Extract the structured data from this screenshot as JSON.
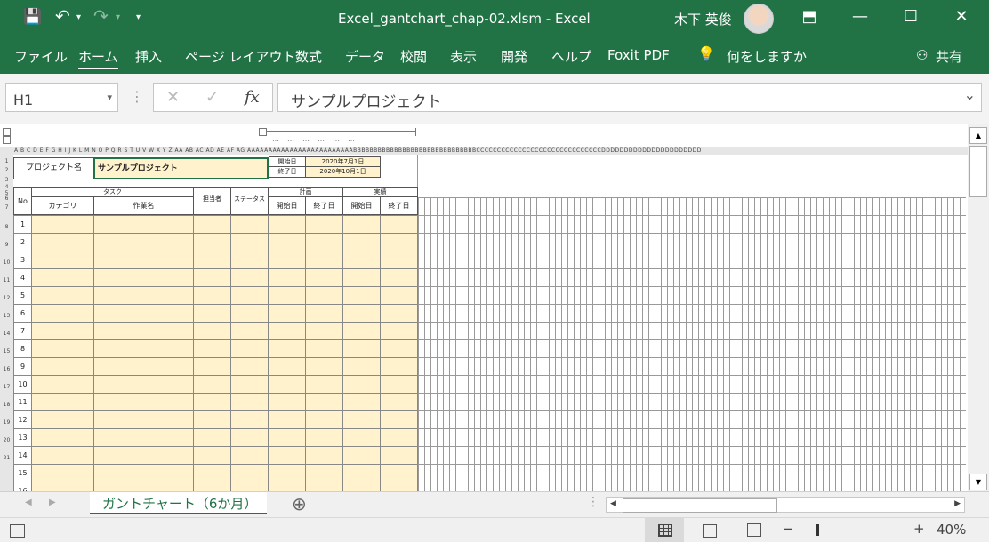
{
  "titlebar": {
    "doc_title": "Excel_gantchart_chap-02.xlsm  -  Excel",
    "user_name": "木下 英俊",
    "save_glyph": "💾",
    "undo_glyph": "↶",
    "redo_glyph": "↷",
    "customize_glyph": "▾",
    "ribbon_display_glyph": "⬒",
    "minimize_glyph": "—",
    "maximize_glyph": "☐",
    "close_glyph": "✕"
  },
  "ribbon": {
    "tabs": [
      "ファイル",
      "ホーム",
      "挿入",
      "ページ レイアウト",
      "数式",
      "データ",
      "校閲",
      "表示",
      "開発",
      "ヘルプ",
      "Foxit PDF"
    ],
    "search_icon_glyph": "💡",
    "search_label": "何をしますか",
    "share_label": "共有",
    "share_icon_glyph": "⚇"
  },
  "formula_bar": {
    "name_box": "H1",
    "name_box_arrow": "▾",
    "cancel_glyph": "✕",
    "enter_glyph": "✓",
    "fx_glyph": "fx",
    "formula_value": "サンプルプロジェクト",
    "expand_glyph": "⌄",
    "dots_glyph": "⋮"
  },
  "sheet": {
    "col_header_text": "A B C D E F G H I J K L M N O P Q R S T U V W X Y Z AA AB AC AD AE AF AG AAAAAAAAAAAAAAAAAAAAAAAAABBBBBBBBBBBBBBBBBBBBBBBBBBBBBBCCCCCCCCCCCCCCCCCCCCCCCCCCCCCCDDDDDDDDDDDDDDDDDDDDDD",
    "row_numbers": [
      "1",
      "2",
      "3",
      "4",
      "5",
      "6",
      "7",
      "8",
      "9",
      "10",
      "11",
      "12",
      "13",
      "14",
      "15",
      "16",
      "17",
      "18",
      "19",
      "20",
      "21"
    ],
    "project_label": "プロジェクト名",
    "project_name": "サンプルプロジェクト",
    "start_label": "開始日",
    "start_value": "2020年7月1日",
    "end_label": "終了日",
    "end_value": "2020年10月1日",
    "task_header": "タスク",
    "plan_header": "計画",
    "actual_header": "実績",
    "no_header": "No",
    "category_header": "カテゴリ",
    "work_header": "作業名",
    "owner_header": "担当者",
    "status_header": "ステータス",
    "plan_start": "開始日",
    "plan_end": "終了日",
    "actual_start": "開始日",
    "actual_end": "終了日",
    "task_numbers": [
      "1",
      "2",
      "3",
      "4",
      "5",
      "6",
      "7",
      "8",
      "9",
      "10",
      "11",
      "12",
      "13",
      "14",
      "15",
      "16"
    ]
  },
  "sheet_tabs": {
    "active_tab": "ガントチャート（6か月）",
    "add_glyph": "⊕",
    "nav_left": "◀",
    "nav_right": "▶"
  },
  "status_bar": {
    "zoom": "40%",
    "zoom_minus": "−",
    "zoom_plus": "+"
  }
}
